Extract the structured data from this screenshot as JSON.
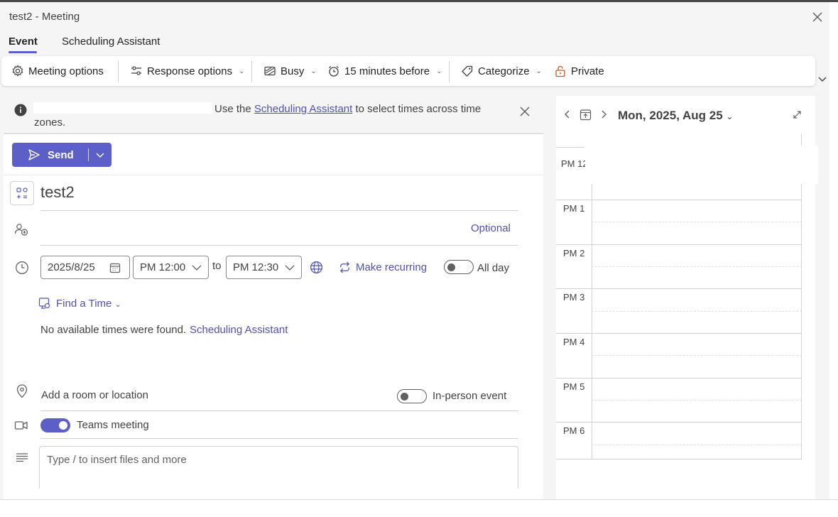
{
  "window": {
    "title": "test2 - Meeting"
  },
  "tabs": [
    {
      "label": "Event",
      "active": true
    },
    {
      "label": "Scheduling Assistant",
      "active": false
    }
  ],
  "toolbar": {
    "meeting_options": "Meeting options",
    "response_options": "Response options",
    "show_as": "Busy",
    "reminder": "15 minutes before",
    "categorize": "Categorize",
    "private": "Private"
  },
  "banner": {
    "text_before": "Use the ",
    "link": "Scheduling Assistant",
    "text_after": " to select times across time zones."
  },
  "send": {
    "label": "Send"
  },
  "event": {
    "title": "test2",
    "attendees_optional": "Optional",
    "start_date": "2025/8/25",
    "start_time": "PM 12:00",
    "to_label": "to",
    "end_time": "PM 12:30",
    "make_recurring": "Make recurring",
    "all_day": "All day",
    "all_day_on": false,
    "find_time": "Find a Time",
    "no_times_text": "No available times were found.",
    "no_times_link": "Scheduling Assistant",
    "location_placeholder": "Add a room or location",
    "in_person": "In-person event",
    "in_person_on": false,
    "teams_meeting": "Teams meeting",
    "teams_meeting_on": true,
    "notes_placeholder": "Type / to insert files and more"
  },
  "calendar": {
    "date_label": "Mon, 2025, Aug 25",
    "hours": [
      "PM 12",
      "PM 1",
      "PM 2",
      "PM 3",
      "PM 4",
      "PM 5",
      "PM 6"
    ]
  },
  "colors": {
    "accent": "#5b5fc7",
    "link": "#4f52b2"
  }
}
